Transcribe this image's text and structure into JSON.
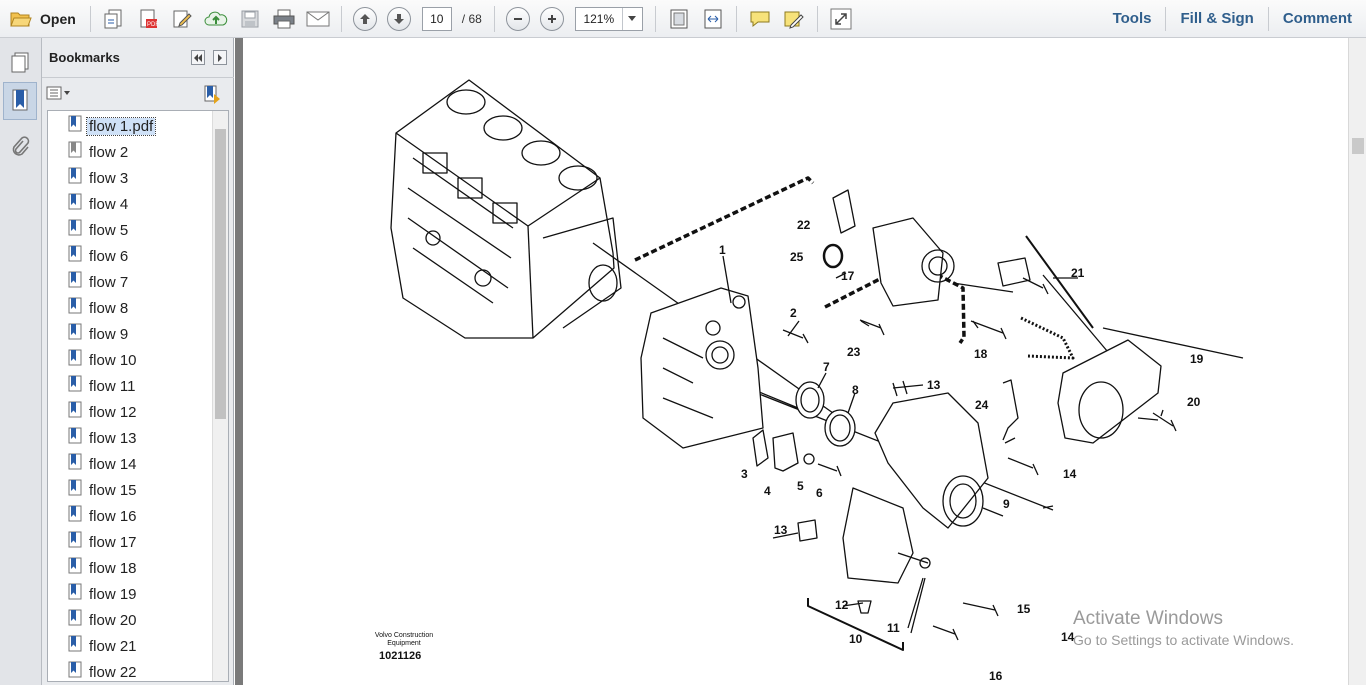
{
  "toolbar": {
    "open_label": "Open",
    "current_page": "10",
    "total_pages": "/ 68",
    "zoom": "121%",
    "tools_label": "Tools",
    "fill_sign_label": "Fill & Sign",
    "comment_label": "Comment"
  },
  "bookmarks": {
    "title": "Bookmarks",
    "items": [
      {
        "label": "flow 1.pdf"
      },
      {
        "label": "flow 2"
      },
      {
        "label": "flow 3"
      },
      {
        "label": "flow 4"
      },
      {
        "label": "flow 5"
      },
      {
        "label": "flow 6"
      },
      {
        "label": "flow 7"
      },
      {
        "label": "flow 8"
      },
      {
        "label": "flow 9"
      },
      {
        "label": "flow 10"
      },
      {
        "label": "flow 11"
      },
      {
        "label": "flow 12"
      },
      {
        "label": "flow 13"
      },
      {
        "label": "flow 14"
      },
      {
        "label": "flow 15"
      },
      {
        "label": "flow 16"
      },
      {
        "label": "flow 17"
      },
      {
        "label": "flow 18"
      },
      {
        "label": "flow 19"
      },
      {
        "label": "flow 20"
      },
      {
        "label": "flow 21"
      },
      {
        "label": "flow 22"
      }
    ]
  },
  "document": {
    "part_labels": [
      "1",
      "2",
      "3",
      "4",
      "5",
      "6",
      "7",
      "8",
      "9",
      "10",
      "11",
      "12",
      "13",
      "13",
      "14",
      "14",
      "15",
      "16",
      "17",
      "18",
      "19",
      "20",
      "21",
      "22",
      "23",
      "24",
      "25"
    ],
    "footer_company": "Volvo Construction",
    "footer_company2": "Equipment",
    "footer_number": "1021126"
  },
  "watermark": {
    "title": "Activate Windows",
    "subtitle": "Go to Settings to activate Windows."
  },
  "colors": {
    "link": "#2f5e8c",
    "selection": "#cfe1f7"
  }
}
